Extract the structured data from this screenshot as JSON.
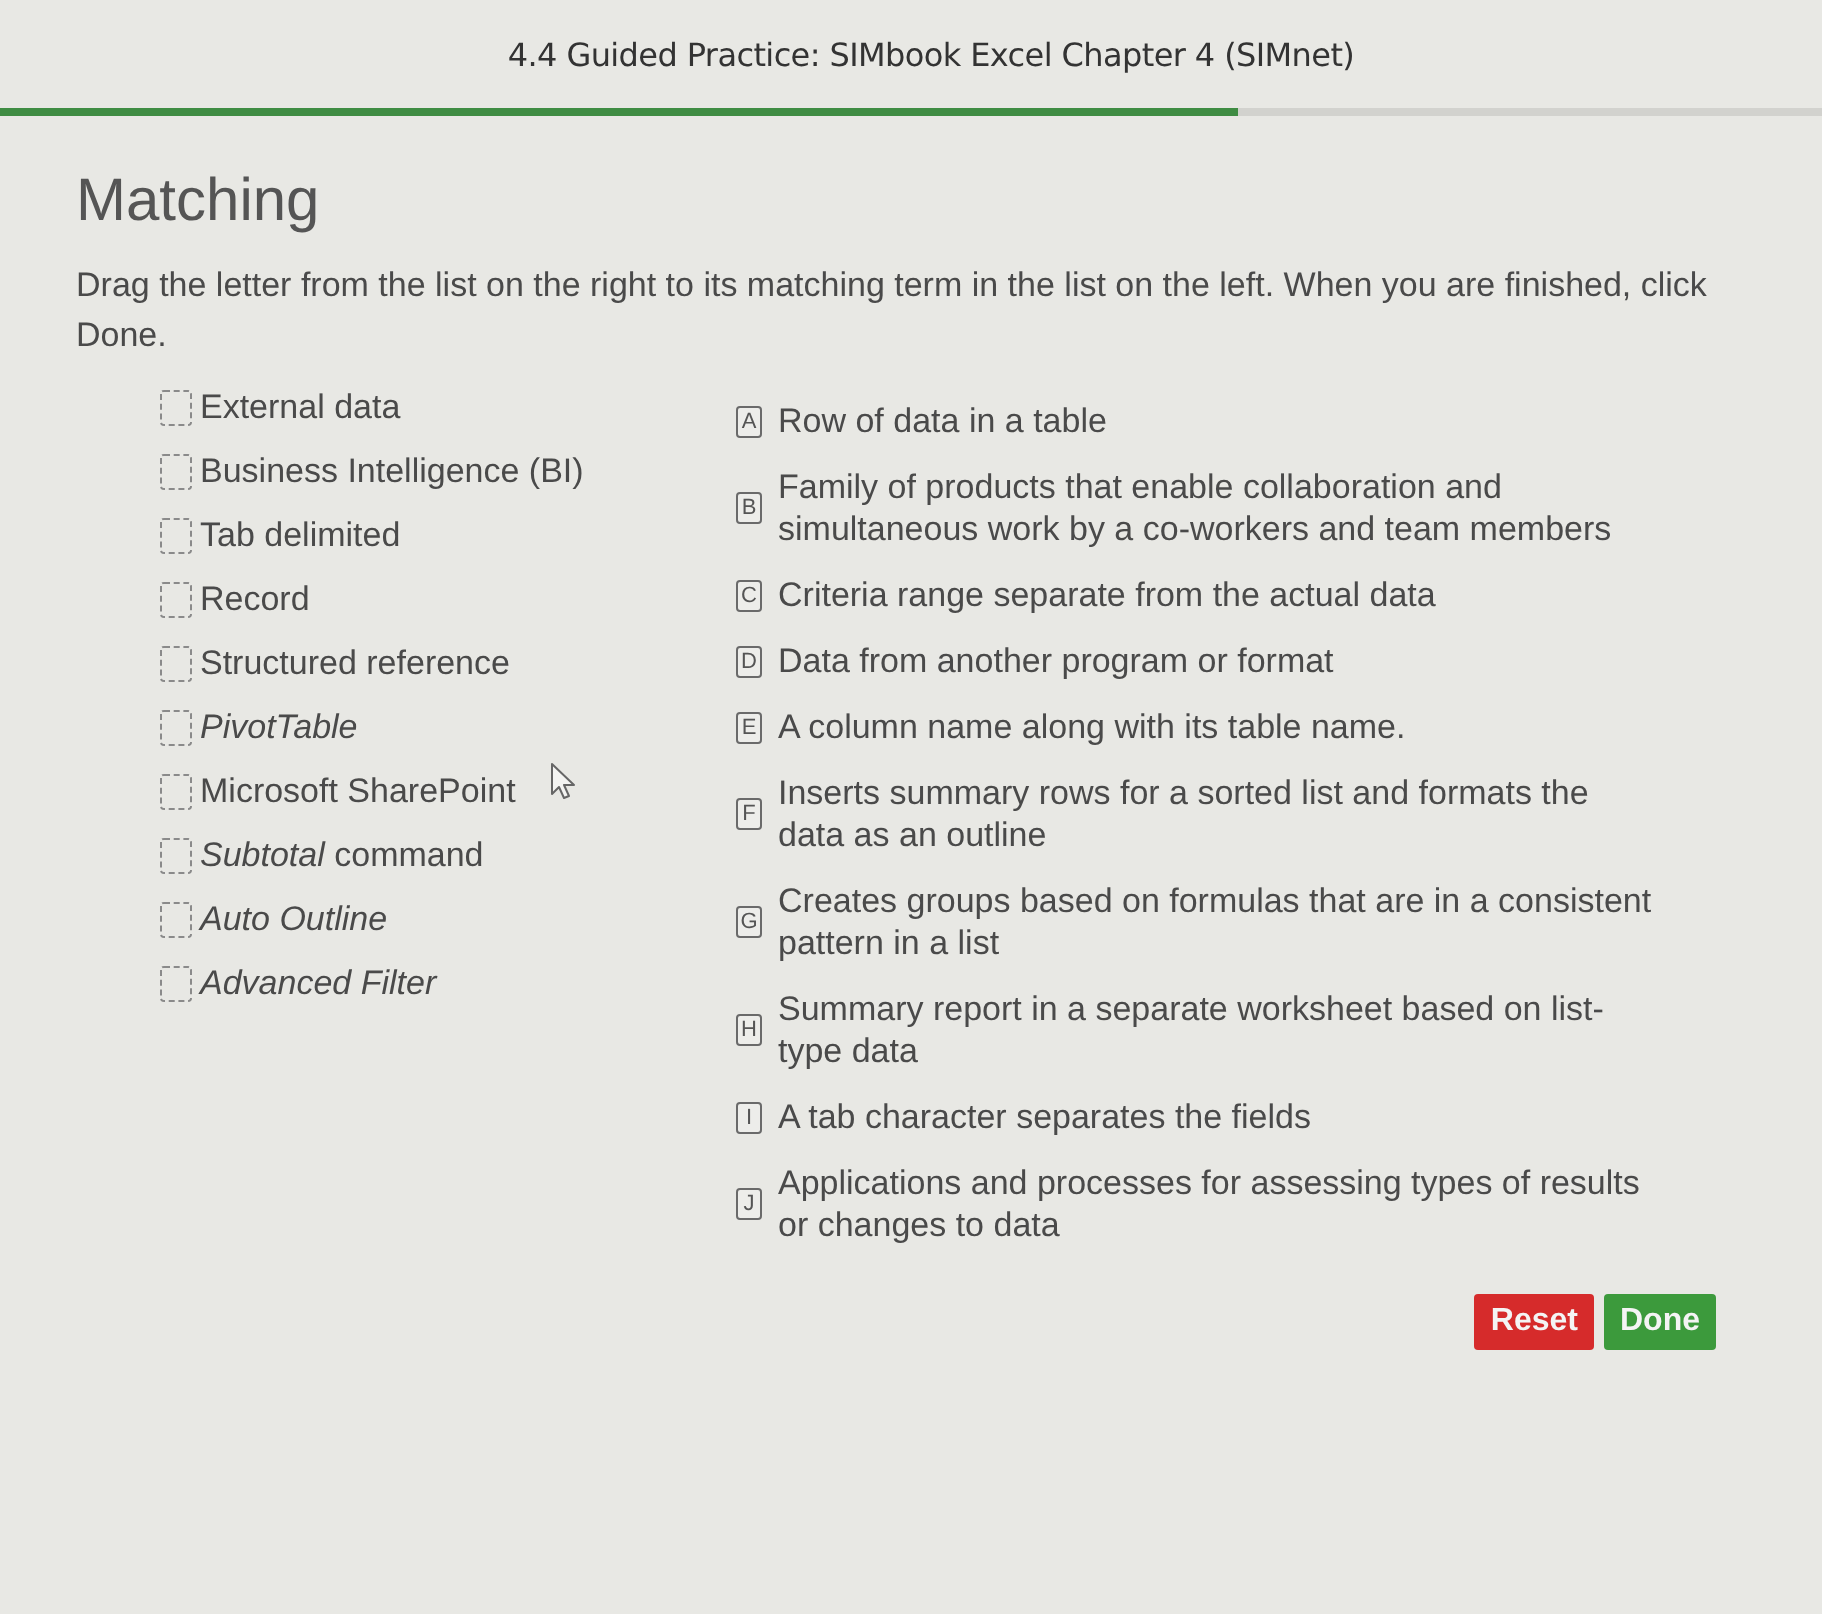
{
  "header": {
    "title": "4.4 Guided Practice: SIMbook Excel Chapter 4 (SIMnet)",
    "progress": {
      "level": 0.68
    }
  },
  "heading": "Matching",
  "instructions": "Drag the letter from the list on the right to its matching term in the list on the left. When you are finished, click Done.",
  "terms": [
    {
      "label": "External data",
      "italic": false
    },
    {
      "label": "Business Intelligence (BI)",
      "italic": false
    },
    {
      "label": "Tab delimited",
      "italic": false
    },
    {
      "label": "Record",
      "italic": false
    },
    {
      "label": "Structured reference",
      "italic": false
    },
    {
      "label": "PivotTable",
      "italic": true
    },
    {
      "label": "Microsoft SharePoint",
      "italic": false
    },
    {
      "label": "*Subtotal* command",
      "italic": false
    },
    {
      "label": "Auto Outline",
      "italic": true
    },
    {
      "label": "Advanced Filter",
      "italic": true
    }
  ],
  "definitions": [
    {
      "letter": "A",
      "text": "Row of data in a table"
    },
    {
      "letter": "B",
      "text": "Family of products that enable collaboration and simultaneous work by a co-workers and team members"
    },
    {
      "letter": "C",
      "text": "Criteria range separate from the actual data"
    },
    {
      "letter": "D",
      "text": "Data from another program or format"
    },
    {
      "letter": "E",
      "text": "A column name along with its table name."
    },
    {
      "letter": "F",
      "text": "Inserts summary rows for a sorted list and formats the data as an outline"
    },
    {
      "letter": "G",
      "text": "Creates groups based on formulas that are in a consistent pattern in a list"
    },
    {
      "letter": "H",
      "text": "Summary report in a separate worksheet based on list-type data"
    },
    {
      "letter": "I",
      "text": "A tab character separates the fields"
    },
    {
      "letter": "J",
      "text": "Applications and processes for assessing types of results or changes to data"
    }
  ],
  "buttons": [
    {
      "label": "Reset",
      "kind": "reset"
    },
    {
      "label": "Done",
      "kind": "done"
    }
  ]
}
